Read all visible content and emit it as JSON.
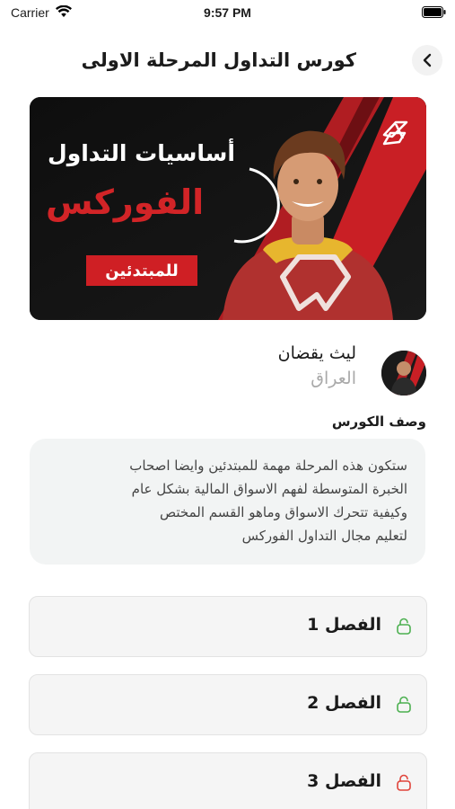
{
  "status_bar": {
    "carrier": "Carrier",
    "time": "9:57 PM"
  },
  "header": {
    "title": "كورس التداول المرحلة الاولى",
    "back_icon": "chevron-left-icon"
  },
  "banner": {
    "title_line1": "أساسيات التداول",
    "title_line2": "الفوركس",
    "tag": "للمبتدئين",
    "colors": {
      "accent": "#d22427",
      "background": "#111111"
    }
  },
  "instructor": {
    "name": "ليث يقضان",
    "country": "العراق"
  },
  "course": {
    "description_title": "وصف الكورس",
    "description_lines": [
      "ستكون هذه المرحلة مهمة للمبتدئين وايضا اصحاب",
      "الخبرة المتوسطة لفهم الاسواق المالية بشكل عام",
      "وكيفية تتحرك الاسواق وماهو القسم المختص",
      "لتعليم مجال التداول الفوركس"
    ]
  },
  "chapters": [
    {
      "label": "الفصل 1",
      "lock_state": "unlocked",
      "lock_color": "#4cb050"
    },
    {
      "label": "الفصل 2",
      "lock_state": "unlocked",
      "lock_color": "#4cb050"
    },
    {
      "label": "الفصل 3",
      "lock_state": "locked",
      "lock_color": "#e0433a"
    }
  ]
}
